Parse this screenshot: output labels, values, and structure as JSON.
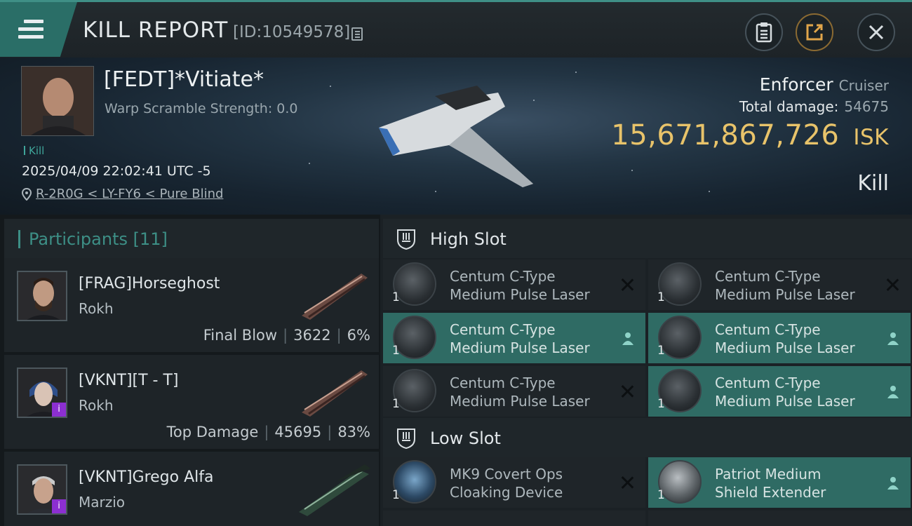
{
  "header": {
    "title": "KILL REPORT",
    "report_id": "[ID:10549578]"
  },
  "victim": {
    "name": "[FEDT]*Vitiate*",
    "warp_scramble": "Warp Scramble Strength: 0.0",
    "tag": "Kill",
    "timestamp": "2025/04/09 22:02:41 UTC -5",
    "location": "R-2R0G < LY-FY6 < Pure Blind",
    "ship_name": "Enforcer",
    "ship_class": "Cruiser",
    "total_damage_label": "Total damage:",
    "total_damage": "54675",
    "isk_value": "15,671,867,726",
    "isk_unit": "ISK",
    "result": "Kill"
  },
  "participants": {
    "label": "Participants",
    "count": "[11]",
    "items": [
      {
        "name": "[FRAG]Horseghost",
        "ship": "Rokh",
        "tag": "Final Blow",
        "damage": "3622",
        "percent": "6%"
      },
      {
        "name": "[VKNT][T - T]",
        "ship": "Rokh",
        "tag": "Top Damage",
        "damage": "45695",
        "percent": "83%"
      },
      {
        "name": "[VKNT]Grego Alfa",
        "ship": "Marzio",
        "tag": "",
        "damage": "",
        "percent": ""
      }
    ]
  },
  "slots": {
    "high": {
      "label": "High Slot",
      "modules": [
        {
          "line1": "Centum C-Type",
          "line2": "Medium Pulse Laser",
          "qty": "1",
          "status": "destroyed"
        },
        {
          "line1": "Centum C-Type",
          "line2": "Medium Pulse Laser",
          "qty": "1",
          "status": "destroyed"
        },
        {
          "line1": "Centum C-Type",
          "line2": "Medium Pulse Laser",
          "qty": "1",
          "status": "dropped"
        },
        {
          "line1": "Centum C-Type",
          "line2": "Medium Pulse Laser",
          "qty": "1",
          "status": "dropped"
        },
        {
          "line1": "Centum C-Type",
          "line2": "Medium Pulse Laser",
          "qty": "1",
          "status": "destroyed"
        },
        {
          "line1": "Centum C-Type",
          "line2": "Medium Pulse Laser",
          "qty": "1",
          "status": "dropped"
        }
      ]
    },
    "low": {
      "label": "Low Slot",
      "modules": [
        {
          "line1": "MK9 Covert Ops",
          "line2": "Cloaking Device",
          "qty": "1",
          "status": "destroyed"
        },
        {
          "line1": "Patriot Medium",
          "line2": "Shield Extender",
          "qty": "1",
          "status": "dropped"
        }
      ]
    }
  },
  "colors": {
    "accent": "#3d8f86",
    "fitted_bg": "#2f6b64",
    "isk": "#e8c36a",
    "badge": "#8c2fd1"
  }
}
